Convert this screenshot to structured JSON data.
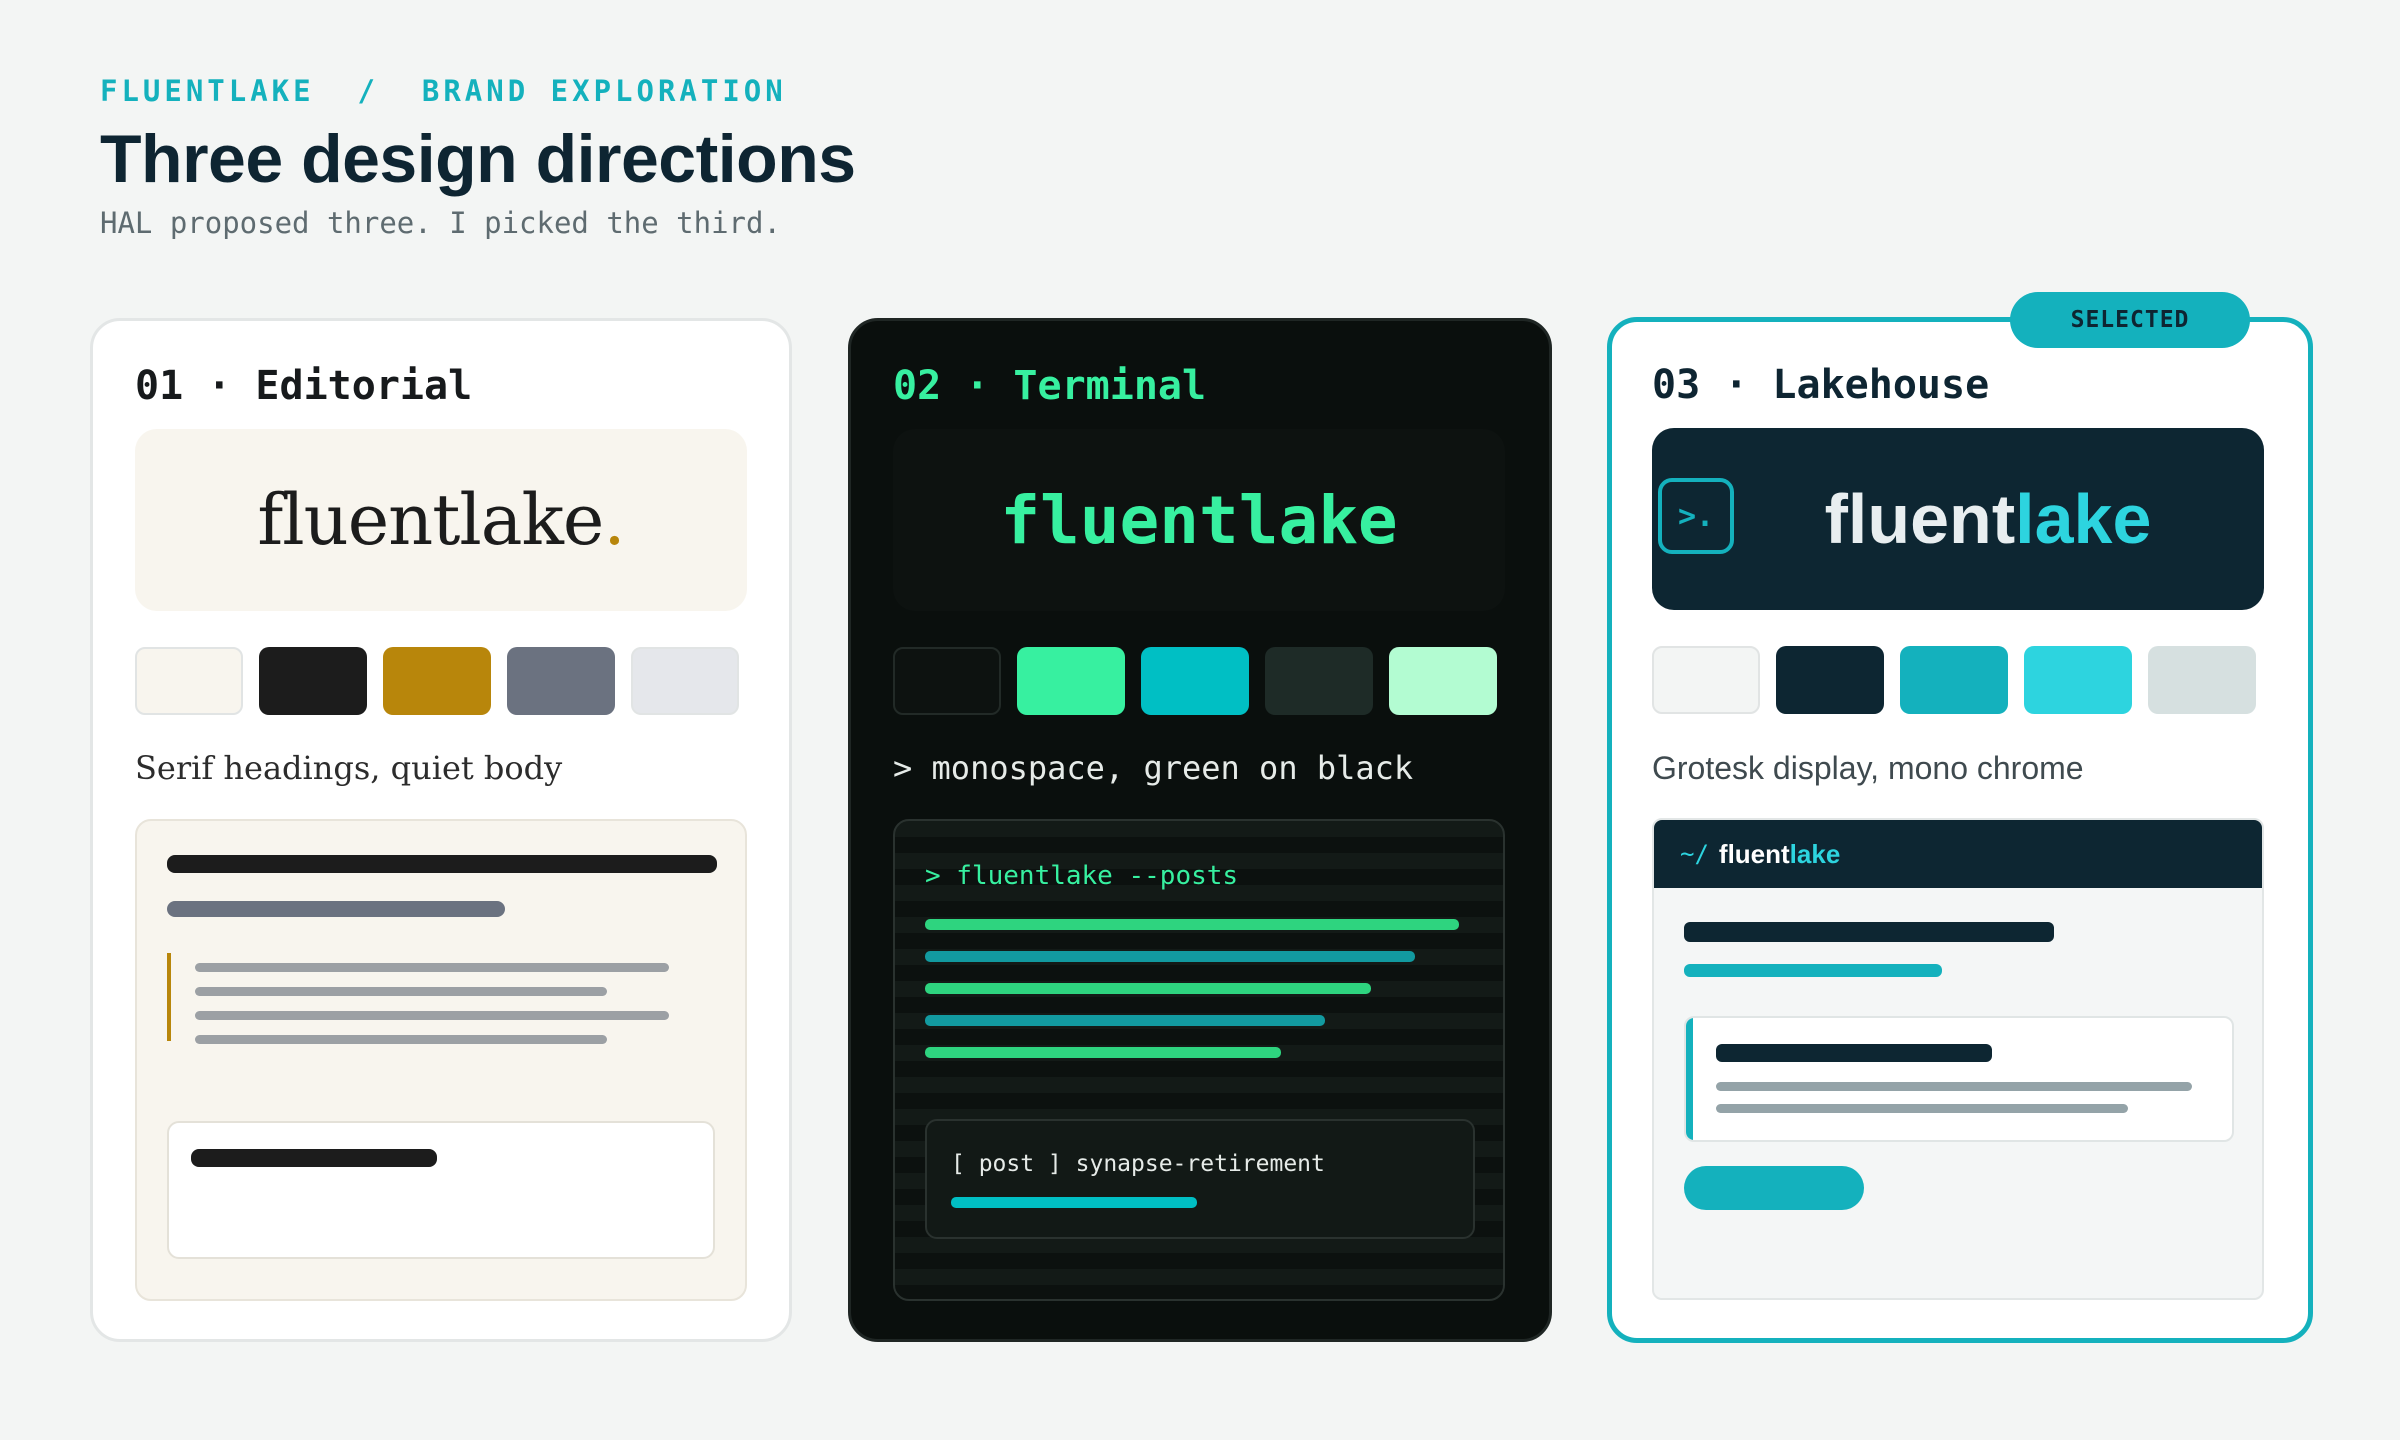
{
  "header": {
    "breadcrumb": "FLUENTLAKE  /  BRAND EXPLORATION",
    "title": "Three design directions",
    "subtitle": "HAL proposed three. I picked the third."
  },
  "cards": [
    {
      "heading": "01 · Editorial",
      "logo_text": "fluentlake",
      "logo_dot": ".",
      "tagline": "Serif headings, quiet body",
      "swatches": [
        "#f8f5ee",
        "#1c1c1c",
        "#b8860b",
        "#6b7280",
        "#e5e7eb"
      ]
    },
    {
      "heading": "02 · Terminal",
      "logo_text": "fluentlake",
      "tagline": "> monospace, green on black",
      "swatches": [
        "#0d1210",
        "#37f0a0",
        "#00bfc4",
        "#1e2b27",
        "#b3fcd2"
      ],
      "preview_command": "> fluentlake --posts",
      "preview_post": "[ post ] synapse-retirement"
    },
    {
      "heading": "03 · Lakehouse",
      "logo_mark": ">.",
      "logo_text_a": "fluent",
      "logo_text_b": "lake",
      "tagline": "Grotesk display, mono chrome",
      "swatches": [
        "#f3f5f4",
        "#0d2632",
        "#14b1bd",
        "#2dd4df",
        "#d6e0e0"
      ],
      "preview_path": "~/",
      "preview_brand_a": "fluent",
      "preview_brand_b": "lake"
    }
  ],
  "selected_badge": "SELECTED",
  "colors": {
    "accent": "#14b1bd",
    "terminal_green": "#37f0a0",
    "editorial_gold": "#b8860b",
    "lakehouse_navy": "#0d2632"
  }
}
